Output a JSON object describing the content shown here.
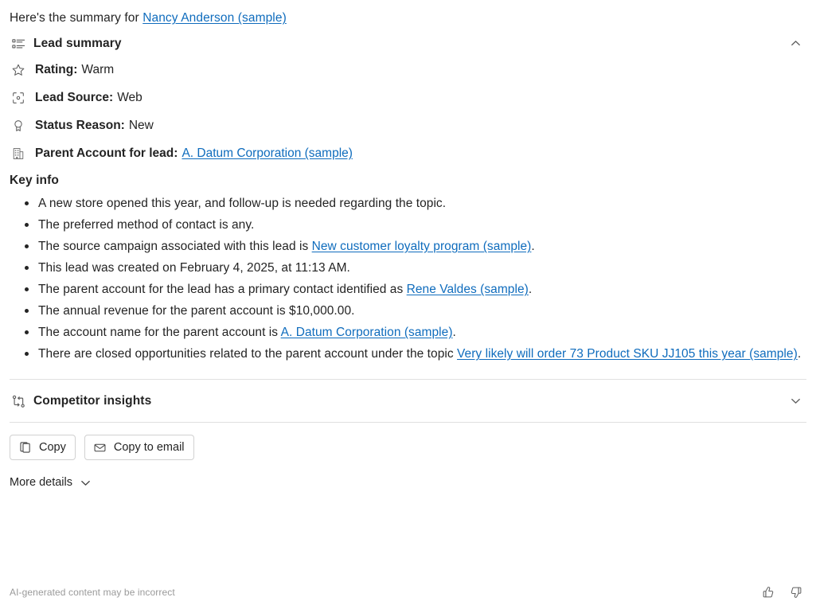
{
  "intro": {
    "prefix": "Here's the summary for ",
    "link_text": "Nancy Anderson (sample)"
  },
  "lead_summary": {
    "title": "Lead summary",
    "icon": "summary-list-icon",
    "collapse_icon": "chevron-up-icon",
    "attributes": [
      {
        "icon": "star-icon",
        "label": "Rating:",
        "value": "Warm",
        "link": false
      },
      {
        "icon": "target-icon",
        "label": "Lead Source:",
        "value": "Web",
        "link": false
      },
      {
        "icon": "badge-icon",
        "label": "Status Reason:",
        "value": "New",
        "link": false
      },
      {
        "icon": "building-icon",
        "label": "Parent Account for lead:",
        "value": "A. Datum Corporation (sample)",
        "link": true
      }
    ],
    "key_info_title": "Key info",
    "key_info": [
      {
        "parts": [
          {
            "text": "A new store opened this year, and follow-up is needed regarding the topic.",
            "link": false
          }
        ]
      },
      {
        "parts": [
          {
            "text": "The preferred method of contact is any.",
            "link": false
          }
        ]
      },
      {
        "parts": [
          {
            "text": "The source campaign associated with this lead is ",
            "link": false
          },
          {
            "text": "New customer loyalty program (sample)",
            "link": true
          },
          {
            "text": ".",
            "link": false
          }
        ]
      },
      {
        "parts": [
          {
            "text": "This lead was created on February 4, 2025, at 11:13 AM.",
            "link": false
          }
        ]
      },
      {
        "parts": [
          {
            "text": "The parent account for the lead has a primary contact identified as ",
            "link": false
          },
          {
            "text": "Rene Valdes (sample)",
            "link": true
          },
          {
            "text": ".",
            "link": false
          }
        ]
      },
      {
        "parts": [
          {
            "text": "The annual revenue for the parent account is $10,000.00.",
            "link": false
          }
        ]
      },
      {
        "parts": [
          {
            "text": "The account name for the parent account is ",
            "link": false
          },
          {
            "text": "A. Datum Corporation (sample)",
            "link": true
          },
          {
            "text": ".",
            "link": false
          }
        ]
      },
      {
        "parts": [
          {
            "text": "There are closed opportunities related to the parent account under the topic ",
            "link": false
          },
          {
            "text": "Very likely will order 73 Product SKU JJ105 this year (sample)",
            "link": true
          },
          {
            "text": ".",
            "link": false
          }
        ]
      }
    ]
  },
  "competitor_insights": {
    "title": "Competitor insights",
    "icon": "branch-flow-icon",
    "collapse_icon": "chevron-down-icon"
  },
  "actions": {
    "copy": {
      "label": "Copy",
      "icon": "copy-icon"
    },
    "copy_to_email": {
      "label": "Copy to email",
      "icon": "mail-icon"
    }
  },
  "more_details": {
    "label": "More details",
    "icon": "chevron-down-icon"
  },
  "footer": {
    "note": "AI-generated content may be incorrect",
    "thumbs_up_icon": "thumbs-up-icon",
    "thumbs_down_icon": "thumbs-down-icon"
  },
  "colors": {
    "link": "#0f6cbd",
    "text": "#242424",
    "muted": "#9a9a9a",
    "divider": "#e0e0e0",
    "border": "#d1d1d1",
    "background": "#ffffff"
  }
}
